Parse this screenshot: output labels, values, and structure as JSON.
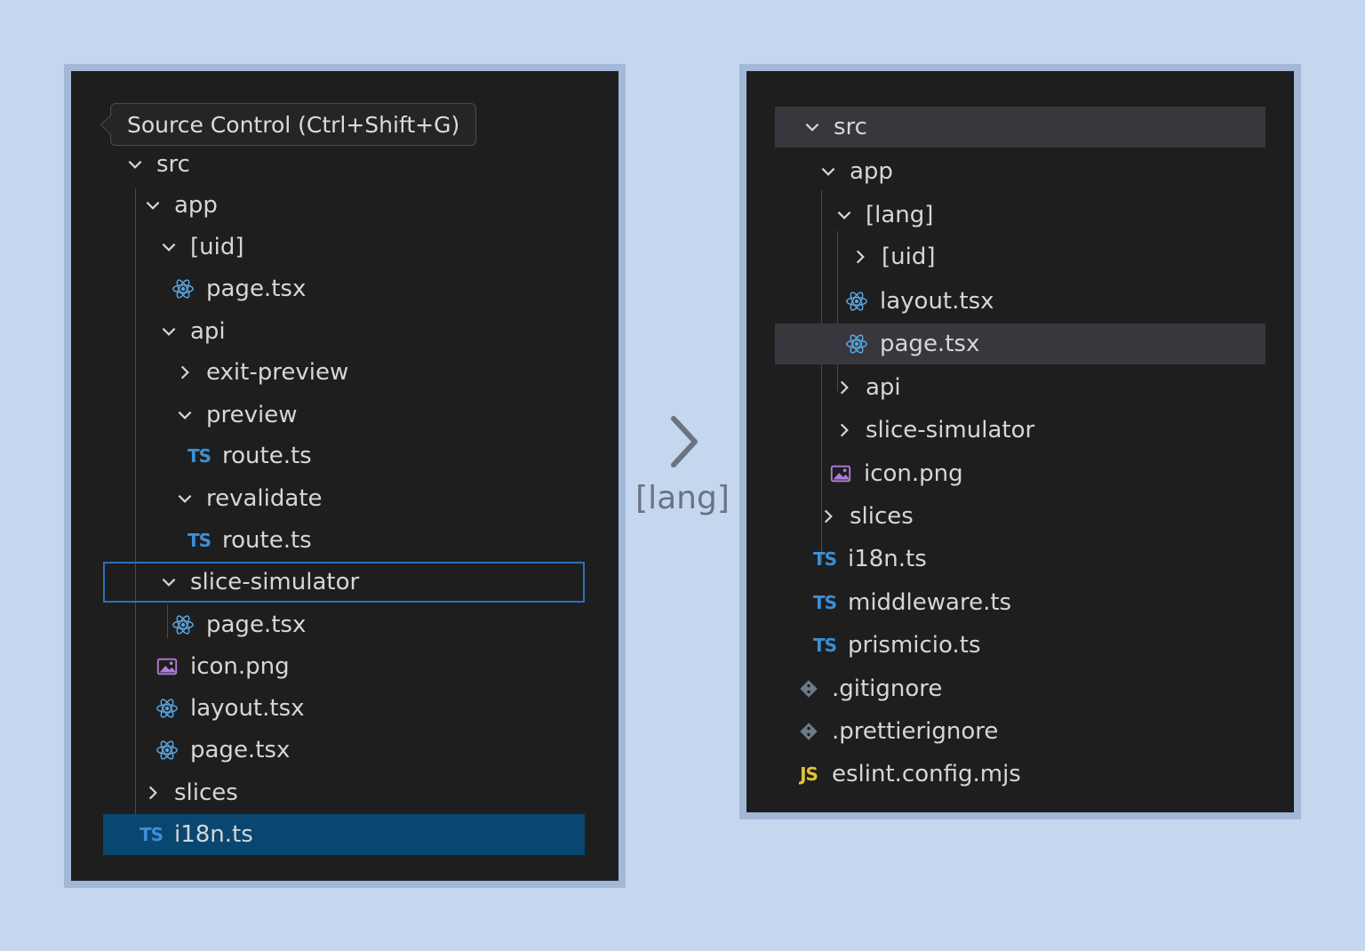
{
  "left_explorer": {
    "tooltip": "Source Control (Ctrl+Shift+G)",
    "rows": [
      {
        "label": "src",
        "kind": "folder-open"
      },
      {
        "label": "app",
        "kind": "folder-open"
      },
      {
        "label": "[uid]",
        "kind": "folder-open"
      },
      {
        "label": "page.tsx",
        "kind": "react"
      },
      {
        "label": "api",
        "kind": "folder-open"
      },
      {
        "label": "exit-preview",
        "kind": "folder-closed"
      },
      {
        "label": "preview",
        "kind": "folder-open"
      },
      {
        "label": "route.ts",
        "kind": "ts",
        "icon_text": "TS"
      },
      {
        "label": "revalidate",
        "kind": "folder-open"
      },
      {
        "label": "route.ts",
        "kind": "ts",
        "icon_text": "TS"
      },
      {
        "label": "slice-simulator",
        "kind": "folder-open"
      },
      {
        "label": "page.tsx",
        "kind": "react"
      },
      {
        "label": "icon.png",
        "kind": "image"
      },
      {
        "label": "layout.tsx",
        "kind": "react"
      },
      {
        "label": "page.tsx",
        "kind": "react"
      },
      {
        "label": "slices",
        "kind": "folder-closed"
      },
      {
        "label": "i18n.ts",
        "kind": "ts",
        "icon_text": "TS"
      }
    ]
  },
  "middle": {
    "label": "[lang]",
    "arrow_icon": "chevron-right-icon"
  },
  "right_explorer": {
    "rows": [
      {
        "label": "src",
        "kind": "folder-open"
      },
      {
        "label": "app",
        "kind": "folder-open"
      },
      {
        "label": "[lang]",
        "kind": "folder-open"
      },
      {
        "label": "[uid]",
        "kind": "folder-closed"
      },
      {
        "label": "layout.tsx",
        "kind": "react"
      },
      {
        "label": "page.tsx",
        "kind": "react"
      },
      {
        "label": "api",
        "kind": "folder-closed"
      },
      {
        "label": "slice-simulator",
        "kind": "folder-closed"
      },
      {
        "label": "icon.png",
        "kind": "image"
      },
      {
        "label": "slices",
        "kind": "folder-closed"
      },
      {
        "label": "i18n.ts",
        "kind": "ts",
        "icon_text": "TS"
      },
      {
        "label": "middleware.ts",
        "kind": "ts",
        "icon_text": "TS"
      },
      {
        "label": "prismicio.ts",
        "kind": "ts",
        "icon_text": "TS"
      },
      {
        "label": ".gitignore",
        "kind": "git"
      },
      {
        "label": ".prettierignore",
        "kind": "git"
      },
      {
        "label": "eslint.config.mjs",
        "kind": "js",
        "icon_text": "JS"
      }
    ]
  },
  "colors": {
    "background": "#c5d7ee",
    "panel": "#1e1e1e",
    "panel_border": "#a3b8d7",
    "selection_outline": "#2f6fb9",
    "selection_filled": "#094771",
    "selection_gray": "#37373d",
    "ts": "#3b8fd6",
    "js": "#e2c23a",
    "react": "#5aa6e0",
    "image": "#b07cd8",
    "git": "#6d7a8a"
  }
}
